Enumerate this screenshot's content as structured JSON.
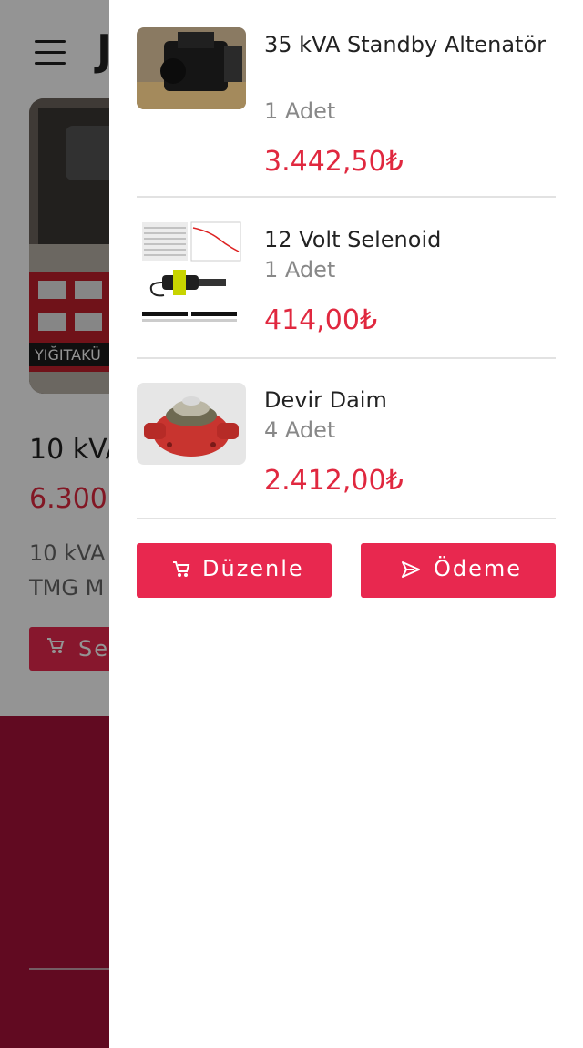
{
  "background_page": {
    "logo_letter": "J",
    "product": {
      "title": "10 kVA",
      "price": "6.300,",
      "desc_line1": "10 kVA",
      "desc_line2": "TMG M",
      "image_brand_text": "YIĞITAKÜ",
      "cart_button_label": "Sep"
    }
  },
  "cart": {
    "items": [
      {
        "name": "35 kVA Standby Altenatör",
        "quantity": "1 Adet",
        "price": "3.442,50₺",
        "thumb_icon": "alternator-image"
      },
      {
        "name": "12 Volt Selenoid",
        "quantity": "1 Adet",
        "price": "414,00₺",
        "thumb_icon": "solenoid-image"
      },
      {
        "name": "Devir Daim",
        "quantity": "4 Adet",
        "price": "2.412,00₺",
        "thumb_icon": "water-pump-image"
      }
    ],
    "edit_button_label": "Düzenle",
    "edit_button_icon": "cart-icon",
    "checkout_button_label": "Ödeme",
    "checkout_button_icon": "send-icon"
  },
  "colors": {
    "accent": "#e8284f",
    "price": "#e0283f",
    "footer": "#a8123a"
  }
}
